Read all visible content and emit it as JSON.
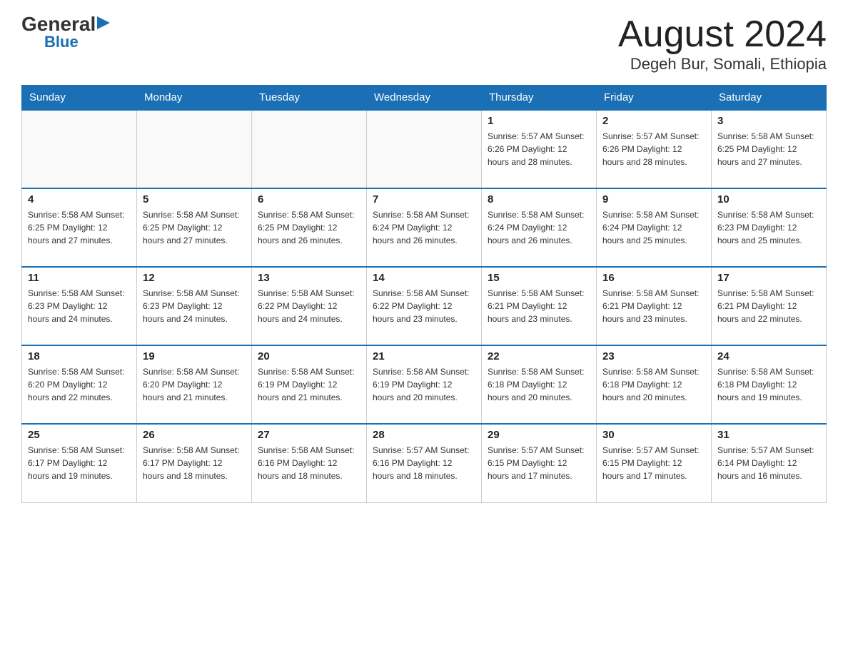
{
  "logo": {
    "general": "General",
    "arrow": "▶",
    "blue": "Blue"
  },
  "title": "August 2024",
  "location": "Degeh Bur, Somali, Ethiopia",
  "days_of_week": [
    "Sunday",
    "Monday",
    "Tuesday",
    "Wednesday",
    "Thursday",
    "Friday",
    "Saturday"
  ],
  "weeks": [
    [
      {
        "day": "",
        "info": ""
      },
      {
        "day": "",
        "info": ""
      },
      {
        "day": "",
        "info": ""
      },
      {
        "day": "",
        "info": ""
      },
      {
        "day": "1",
        "info": "Sunrise: 5:57 AM\nSunset: 6:26 PM\nDaylight: 12 hours and 28 minutes."
      },
      {
        "day": "2",
        "info": "Sunrise: 5:57 AM\nSunset: 6:26 PM\nDaylight: 12 hours and 28 minutes."
      },
      {
        "day": "3",
        "info": "Sunrise: 5:58 AM\nSunset: 6:25 PM\nDaylight: 12 hours and 27 minutes."
      }
    ],
    [
      {
        "day": "4",
        "info": "Sunrise: 5:58 AM\nSunset: 6:25 PM\nDaylight: 12 hours and 27 minutes."
      },
      {
        "day": "5",
        "info": "Sunrise: 5:58 AM\nSunset: 6:25 PM\nDaylight: 12 hours and 27 minutes."
      },
      {
        "day": "6",
        "info": "Sunrise: 5:58 AM\nSunset: 6:25 PM\nDaylight: 12 hours and 26 minutes."
      },
      {
        "day": "7",
        "info": "Sunrise: 5:58 AM\nSunset: 6:24 PM\nDaylight: 12 hours and 26 minutes."
      },
      {
        "day": "8",
        "info": "Sunrise: 5:58 AM\nSunset: 6:24 PM\nDaylight: 12 hours and 26 minutes."
      },
      {
        "day": "9",
        "info": "Sunrise: 5:58 AM\nSunset: 6:24 PM\nDaylight: 12 hours and 25 minutes."
      },
      {
        "day": "10",
        "info": "Sunrise: 5:58 AM\nSunset: 6:23 PM\nDaylight: 12 hours and 25 minutes."
      }
    ],
    [
      {
        "day": "11",
        "info": "Sunrise: 5:58 AM\nSunset: 6:23 PM\nDaylight: 12 hours and 24 minutes."
      },
      {
        "day": "12",
        "info": "Sunrise: 5:58 AM\nSunset: 6:23 PM\nDaylight: 12 hours and 24 minutes."
      },
      {
        "day": "13",
        "info": "Sunrise: 5:58 AM\nSunset: 6:22 PM\nDaylight: 12 hours and 24 minutes."
      },
      {
        "day": "14",
        "info": "Sunrise: 5:58 AM\nSunset: 6:22 PM\nDaylight: 12 hours and 23 minutes."
      },
      {
        "day": "15",
        "info": "Sunrise: 5:58 AM\nSunset: 6:21 PM\nDaylight: 12 hours and 23 minutes."
      },
      {
        "day": "16",
        "info": "Sunrise: 5:58 AM\nSunset: 6:21 PM\nDaylight: 12 hours and 23 minutes."
      },
      {
        "day": "17",
        "info": "Sunrise: 5:58 AM\nSunset: 6:21 PM\nDaylight: 12 hours and 22 minutes."
      }
    ],
    [
      {
        "day": "18",
        "info": "Sunrise: 5:58 AM\nSunset: 6:20 PM\nDaylight: 12 hours and 22 minutes."
      },
      {
        "day": "19",
        "info": "Sunrise: 5:58 AM\nSunset: 6:20 PM\nDaylight: 12 hours and 21 minutes."
      },
      {
        "day": "20",
        "info": "Sunrise: 5:58 AM\nSunset: 6:19 PM\nDaylight: 12 hours and 21 minutes."
      },
      {
        "day": "21",
        "info": "Sunrise: 5:58 AM\nSunset: 6:19 PM\nDaylight: 12 hours and 20 minutes."
      },
      {
        "day": "22",
        "info": "Sunrise: 5:58 AM\nSunset: 6:18 PM\nDaylight: 12 hours and 20 minutes."
      },
      {
        "day": "23",
        "info": "Sunrise: 5:58 AM\nSunset: 6:18 PM\nDaylight: 12 hours and 20 minutes."
      },
      {
        "day": "24",
        "info": "Sunrise: 5:58 AM\nSunset: 6:18 PM\nDaylight: 12 hours and 19 minutes."
      }
    ],
    [
      {
        "day": "25",
        "info": "Sunrise: 5:58 AM\nSunset: 6:17 PM\nDaylight: 12 hours and 19 minutes."
      },
      {
        "day": "26",
        "info": "Sunrise: 5:58 AM\nSunset: 6:17 PM\nDaylight: 12 hours and 18 minutes."
      },
      {
        "day": "27",
        "info": "Sunrise: 5:58 AM\nSunset: 6:16 PM\nDaylight: 12 hours and 18 minutes."
      },
      {
        "day": "28",
        "info": "Sunrise: 5:57 AM\nSunset: 6:16 PM\nDaylight: 12 hours and 18 minutes."
      },
      {
        "day": "29",
        "info": "Sunrise: 5:57 AM\nSunset: 6:15 PM\nDaylight: 12 hours and 17 minutes."
      },
      {
        "day": "30",
        "info": "Sunrise: 5:57 AM\nSunset: 6:15 PM\nDaylight: 12 hours and 17 minutes."
      },
      {
        "day": "31",
        "info": "Sunrise: 5:57 AM\nSunset: 6:14 PM\nDaylight: 12 hours and 16 minutes."
      }
    ]
  ]
}
